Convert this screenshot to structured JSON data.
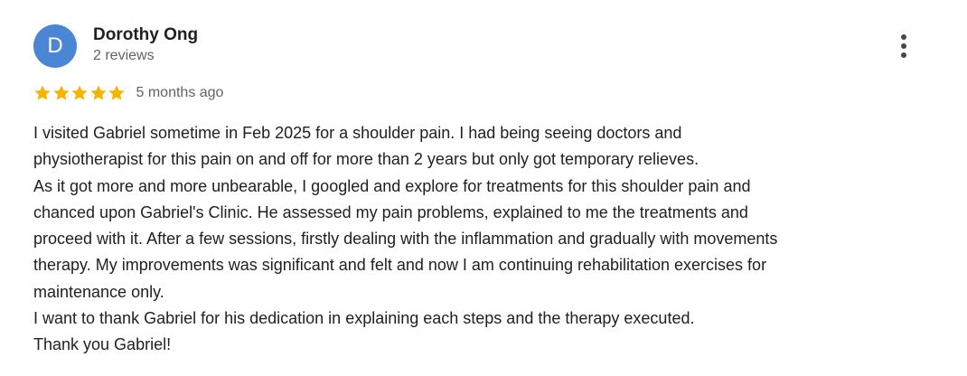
{
  "reviewer": {
    "initial": "D",
    "name": "Dorothy Ong",
    "review_count": "2 reviews",
    "avatar_color": "#4a86d4"
  },
  "rating": {
    "stars": 5,
    "max_stars": 5,
    "star_color": "#f4b400",
    "timestamp": "5 months ago"
  },
  "menu": {
    "icon": "more-vert-icon"
  },
  "review": {
    "lines": [
      "I visited Gabriel sometime in Feb 2025 for a shoulder pain. I had being seeing doctors and",
      "physiotherapist for this pain on and off for more than 2 years but only got temporary relieves.",
      "As it got more and more unbearable, I googled and explore for treatments for this shoulder pain and",
      "chanced upon Gabriel's Clinic. He assessed my pain problems, explained to me the treatments and",
      "proceed with it. After a few sessions, firstly dealing with the inflammation and gradually with movements",
      "therapy. My improvements was significant and felt and now I am continuing rehabilitation exercises for",
      "maintenance only.",
      "I want to thank Gabriel for his dedication in explaining each steps and the therapy executed.",
      "Thank you Gabriel!"
    ]
  }
}
